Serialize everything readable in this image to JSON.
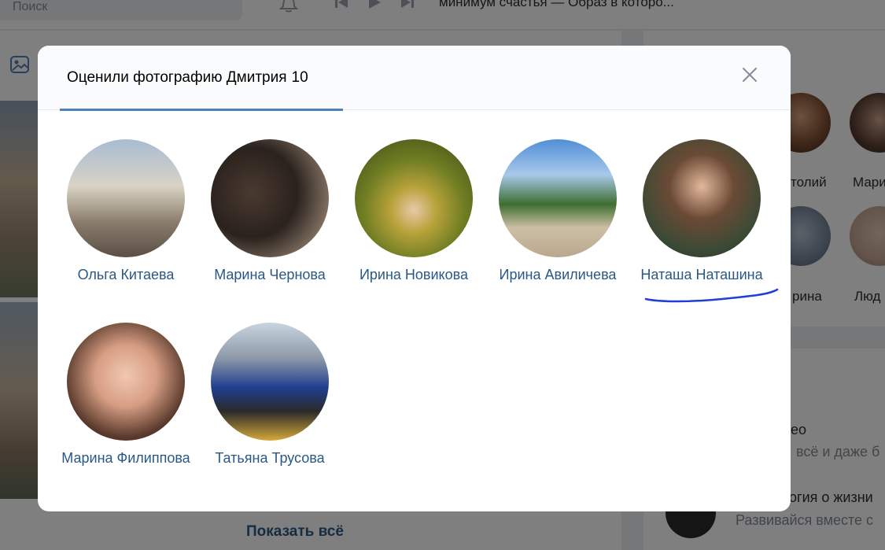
{
  "background": {
    "search_placeholder": "Поиск",
    "now_playing": "минимум счастья — Образ в которо...",
    "show_all": "Показать всё",
    "right_names": [
      "толий",
      "Мари",
      "рина",
      "Люд"
    ],
    "right_texts": [
      "ео",
      "всё и даже б",
      "огия о жизни",
      "Развивайся вместе с"
    ]
  },
  "modal": {
    "title": "Оценили фотографию Дмитрия",
    "count": "10",
    "close_icon": "close-icon"
  },
  "people": [
    {
      "name": "Ольга Китаева"
    },
    {
      "name": "Марина Чернова"
    },
    {
      "name": "Ирина Новикова"
    },
    {
      "name": "Ирина Авиличева"
    },
    {
      "name": "Наташа Наташина"
    },
    {
      "name": "Марина Филиппова"
    },
    {
      "name": "Татьяна Трусова"
    }
  ],
  "colors": {
    "link": "#2a5885",
    "accent": "#5181b8",
    "annotation": "#1f3fd6"
  }
}
